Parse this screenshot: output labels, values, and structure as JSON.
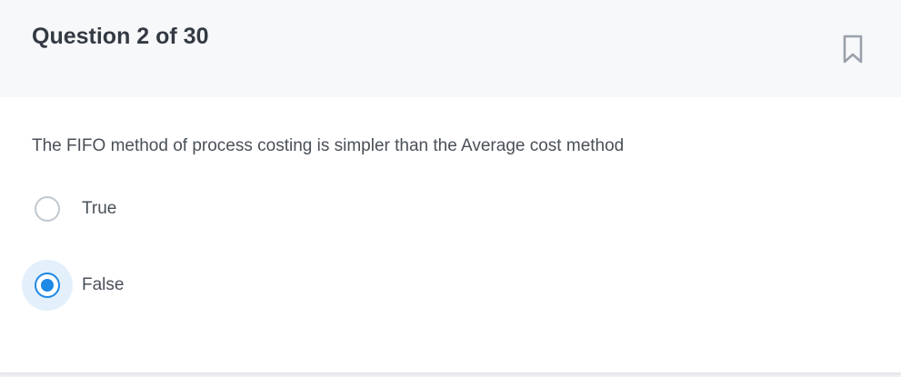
{
  "header": {
    "question_label": "Question 2 of 30"
  },
  "question": {
    "text": "The FIFO method of process costing is simpler than the Average cost method"
  },
  "options": [
    {
      "label": "True",
      "selected": false
    },
    {
      "label": "False",
      "selected": true
    }
  ],
  "icons": {
    "bookmark": "bookmark-icon"
  },
  "colors": {
    "accent": "#1e88e5",
    "selected_halo": "#e3f0fb",
    "header_bg": "#f7f8fa",
    "title_text": "#333a43",
    "body_text": "#4a5058",
    "radio_border": "#c2c8d0"
  }
}
